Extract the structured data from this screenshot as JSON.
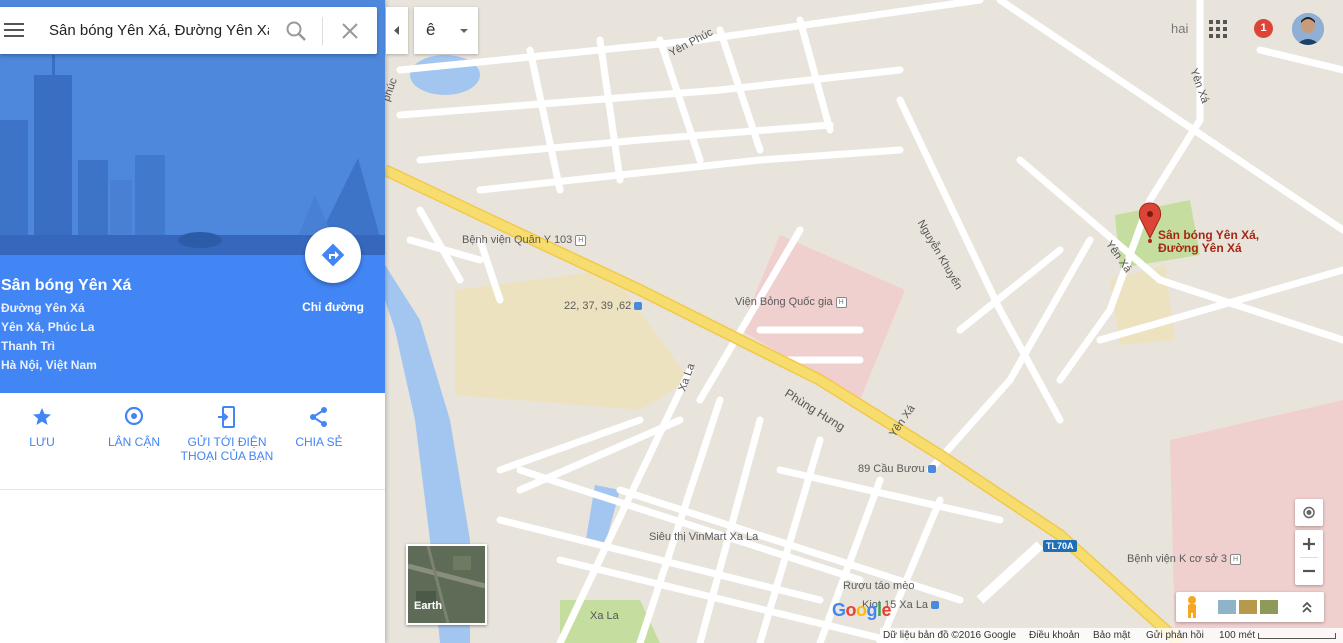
{
  "search": {
    "value": "Sân bóng Yên Xá, Đường Yên Xá, Y"
  },
  "layer_toggle": {
    "label": "ê"
  },
  "account": {
    "name": "hai",
    "notifications": "1"
  },
  "place": {
    "name": "Sân bóng Yên Xá",
    "address_lines": [
      "Đường Yên Xá",
      "Yên Xá, Phúc La",
      "Thanh Trì",
      "Hà Nội, Việt Nam"
    ],
    "directions_label": "Chỉ đường"
  },
  "actions": [
    {
      "label": "LƯU",
      "icon": "star-icon"
    },
    {
      "label": "LÂN CẬN",
      "icon": "nearby-pin-icon"
    },
    {
      "label": "GỬI TỚI ĐIỆN THOẠI CỦA BẠN",
      "icon": "send-to-phone-icon"
    },
    {
      "label": "CHIA SẺ",
      "icon": "share-icon"
    }
  ],
  "map": {
    "marker_label_line1": "Sân bóng Yên Xá,",
    "marker_label_line2": "Đường Yên Xá",
    "labels": {
      "yen_phuc": "Yên Phúc",
      "phuc": "phúc",
      "yen_xa_top": "Yên Xá",
      "yen_xa_marker": "Yên Xá",
      "yen_xa_mid": "Yên Xá",
      "nguyen_khuyen": "Nguyễn Khuyến",
      "benh_vien_quan_y": "Bệnh viện Quân Y 103",
      "vien_bong": "Viện Bỏng Quốc gia",
      "bus_22": "22, 37, 39 ,62",
      "xa_la_road": "Xa La",
      "phung_hung": "Phùng Hưng",
      "cau_buou": "89 Cầu Bươu",
      "vinmart": "Siêu thị VinMart Xa La",
      "ruou": "Rượu táo mèo",
      "kiot": "Kiot 15 Xa La",
      "xa_la_bottom": "Xa La",
      "benh_vien_k": "Bệnh viện K cơ sở 3",
      "tl70a": "TL70A"
    },
    "colors": {
      "water": "#a3c6f1",
      "major_road": "#f7dc6e",
      "land": "#e8e4dc",
      "hospital": "#f0cfcf",
      "park": "#c5dea0",
      "sand": "#ede2c0"
    }
  },
  "earth": {
    "label": "Earth"
  },
  "footer": {
    "map_data": "Dữ liệu bản đồ ©2016 Google",
    "terms": "Điều khoản",
    "privacy": "Bảo mật",
    "feedback": "Gửi phản hồi",
    "scale": "100 mét"
  },
  "logo": {
    "text": "Google"
  }
}
